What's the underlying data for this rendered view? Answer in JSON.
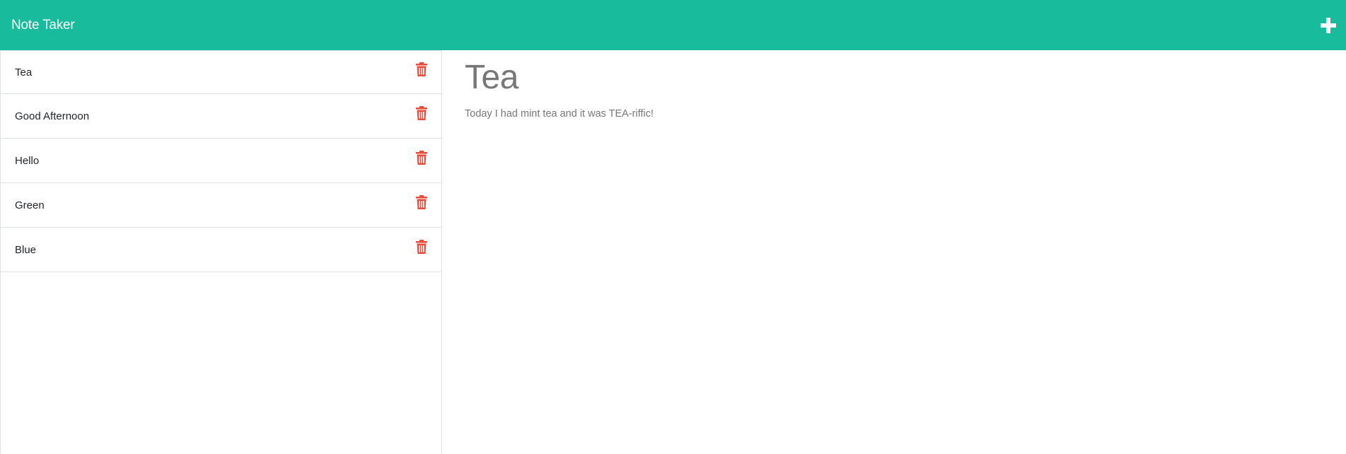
{
  "header": {
    "title": "Note Taker",
    "add_icon": "plus-icon"
  },
  "sidebar": {
    "notes": [
      {
        "title": "Tea",
        "icon": "trash-icon"
      },
      {
        "title": "Good Afternoon",
        "icon": "trash-icon"
      },
      {
        "title": "Hello",
        "icon": "trash-icon"
      },
      {
        "title": "Green",
        "icon": "trash-icon"
      },
      {
        "title": "Blue",
        "icon": "trash-icon"
      }
    ]
  },
  "main": {
    "note_title": "Tea",
    "note_text": "Today I had mint tea and it was TEA-riffic!"
  },
  "colors": {
    "navbar": "#18bc9c",
    "delete_icon": "#e74c3c",
    "note_text": "#777777"
  }
}
